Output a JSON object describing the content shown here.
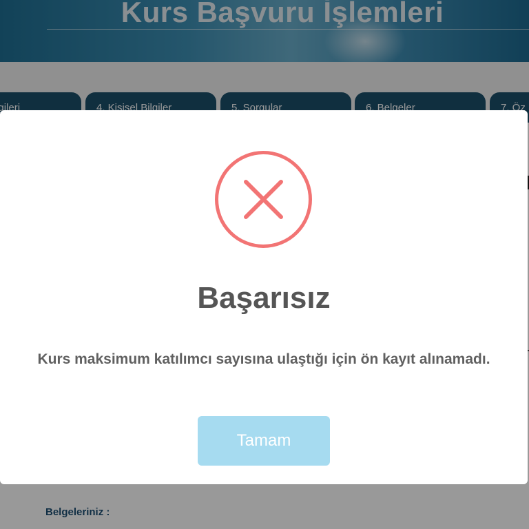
{
  "header": {
    "title": "Kurs Başvuru İşlemleri"
  },
  "steps": [
    {
      "label": "enim Bilgileri"
    },
    {
      "label": "4. Kişisel Bilgiler"
    },
    {
      "label": "5. Sorgular"
    },
    {
      "label": "6. Belgeler"
    },
    {
      "label": "7. Öz"
    }
  ],
  "documents": {
    "label": "Belgeleriniz :"
  },
  "modal": {
    "icon": "error-x-circle-icon",
    "icon_color": "#f27474",
    "title": "Başarısız",
    "message": "Kurs maksimum katılımcı sayısına ulaştığı için ön kayıt alınamadı.",
    "confirm_label": "Tamam",
    "confirm_color": "#a6dbf0"
  }
}
